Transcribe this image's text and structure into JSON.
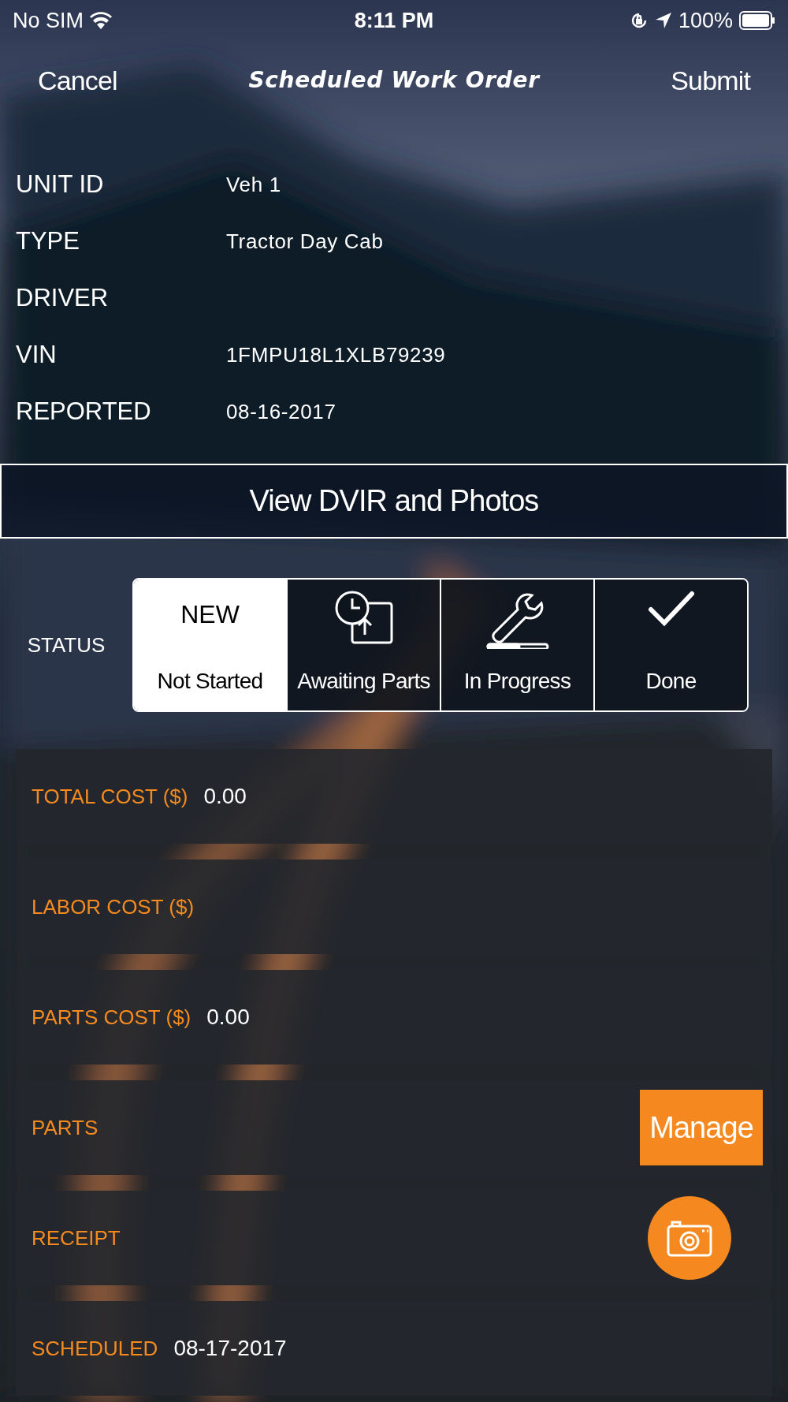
{
  "status_bar": {
    "carrier": "No SIM",
    "time": "8:11 PM",
    "battery": "100%"
  },
  "nav": {
    "cancel": "Cancel",
    "title": "Scheduled Work Order",
    "submit": "Submit"
  },
  "info": [
    {
      "label": "UNIT ID",
      "value": "Veh 1"
    },
    {
      "label": "TYPE",
      "value": "Tractor Day Cab"
    },
    {
      "label": "DRIVER"
    },
    {
      "label": "VIN",
      "value": "1FMPU18L1XLB79239"
    },
    {
      "label": "REPORTED",
      "value": "08-16-2017"
    }
  ],
  "dvir_button": "View DVIR and Photos",
  "status": {
    "label": "STATUS",
    "options": [
      {
        "kind": "new",
        "top": "NEW",
        "label": "Not Started",
        "selected": true
      },
      {
        "kind": "awaiting",
        "label": "Awaiting Parts",
        "selected": false
      },
      {
        "kind": "progress",
        "label": "In Progress",
        "selected": false
      },
      {
        "kind": "done",
        "label": "Done",
        "selected": false
      }
    ]
  },
  "fields": [
    {
      "kind": "value",
      "label": "TOTAL COST ($)",
      "value": "0.00"
    },
    {
      "kind": "value",
      "label": "LABOR COST ($)"
    },
    {
      "kind": "value",
      "label": "PARTS COST ($)",
      "value": "0.00"
    },
    {
      "kind": "button",
      "label": "PARTS",
      "button": "Manage"
    },
    {
      "kind": "camera",
      "label": "RECEIPT"
    },
    {
      "kind": "value",
      "label": "SCHEDULED",
      "value": "08-17-2017"
    }
  ]
}
